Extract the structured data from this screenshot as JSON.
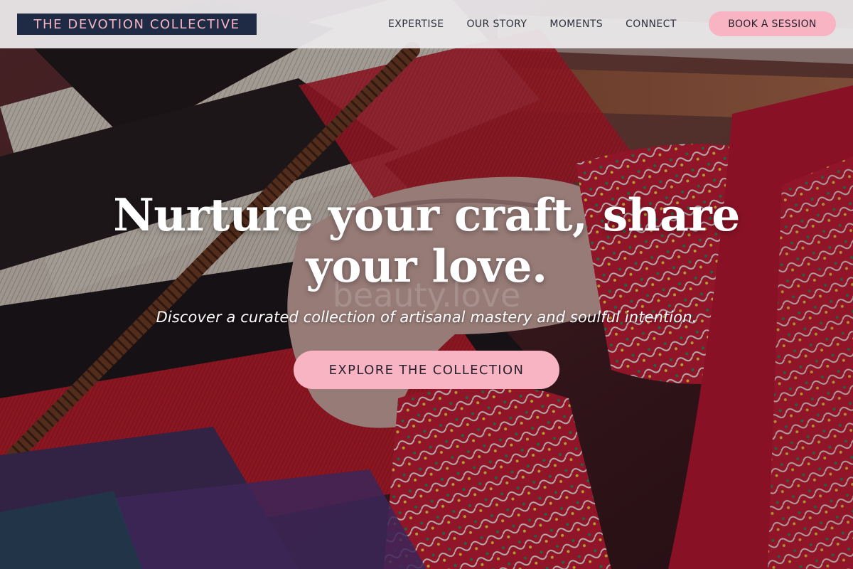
{
  "brand": {
    "logo_text": "THE DEVOTION COLLECTIVE",
    "logo_bg": "#1f2a44",
    "logo_color": "#f5b7c3",
    "accent": "#f8b4c2"
  },
  "nav": {
    "links": [
      {
        "label": "EXPERTISE"
      },
      {
        "label": "OUR STORY"
      },
      {
        "label": "MOMENTS"
      },
      {
        "label": "CONNECT"
      }
    ],
    "cta_label": "BOOK A SESSION"
  },
  "hero": {
    "headline_line1": "Nurture your craft, share",
    "headline_line2": "your love.",
    "subtitle": "Discover a curated collection of artisanal mastery and soulful intention.",
    "cta_label": "EXPLORE THE COLLECTION",
    "watermark": "beauty.love",
    "image_subject": "hands-weaving-on-loom-image"
  }
}
